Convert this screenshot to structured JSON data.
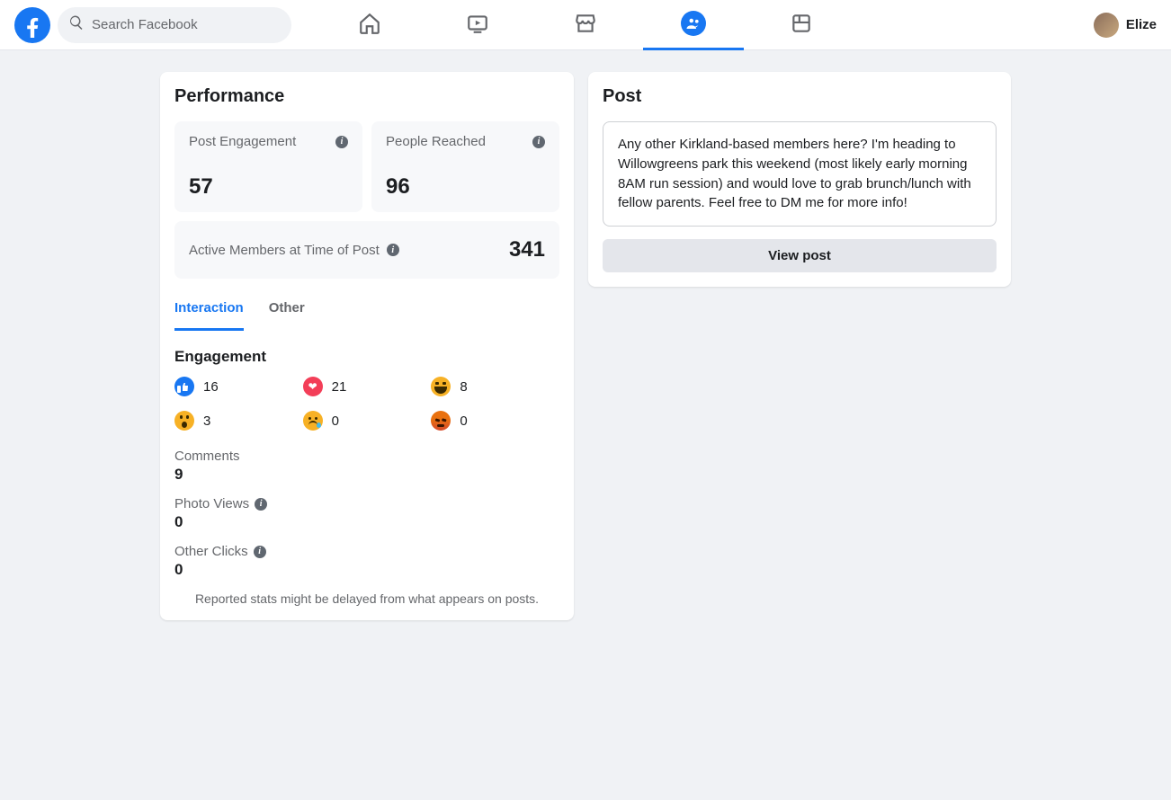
{
  "header": {
    "search_placeholder": "Search Facebook",
    "username": "Elize"
  },
  "perf": {
    "title": "Performance",
    "engagement_label": "Post Engagement",
    "engagement_value": "57",
    "reached_label": "People Reached",
    "reached_value": "96",
    "active_label": "Active Members at Time of Post",
    "active_value": "341",
    "tabs": {
      "interaction": "Interaction",
      "other": "Other"
    },
    "engagement_heading": "Engagement",
    "reactions": {
      "like": "16",
      "love": "21",
      "haha": "8",
      "wow": "3",
      "sad": "0",
      "angry": "0"
    },
    "comments_label": "Comments",
    "comments_value": "9",
    "photo_views_label": "Photo Views",
    "photo_views_value": "0",
    "other_clicks_label": "Other Clicks",
    "other_clicks_value": "0",
    "disclaimer": "Reported stats might be delayed from what appears on posts."
  },
  "post": {
    "title": "Post",
    "body": "Any other Kirkland-based members here? I'm heading to Willowgreens park this weekend (most likely early morning 8AM run session) and would love to grab brunch/lunch with fellow parents. Feel free to DM me for more info!",
    "view_button": "View post"
  }
}
